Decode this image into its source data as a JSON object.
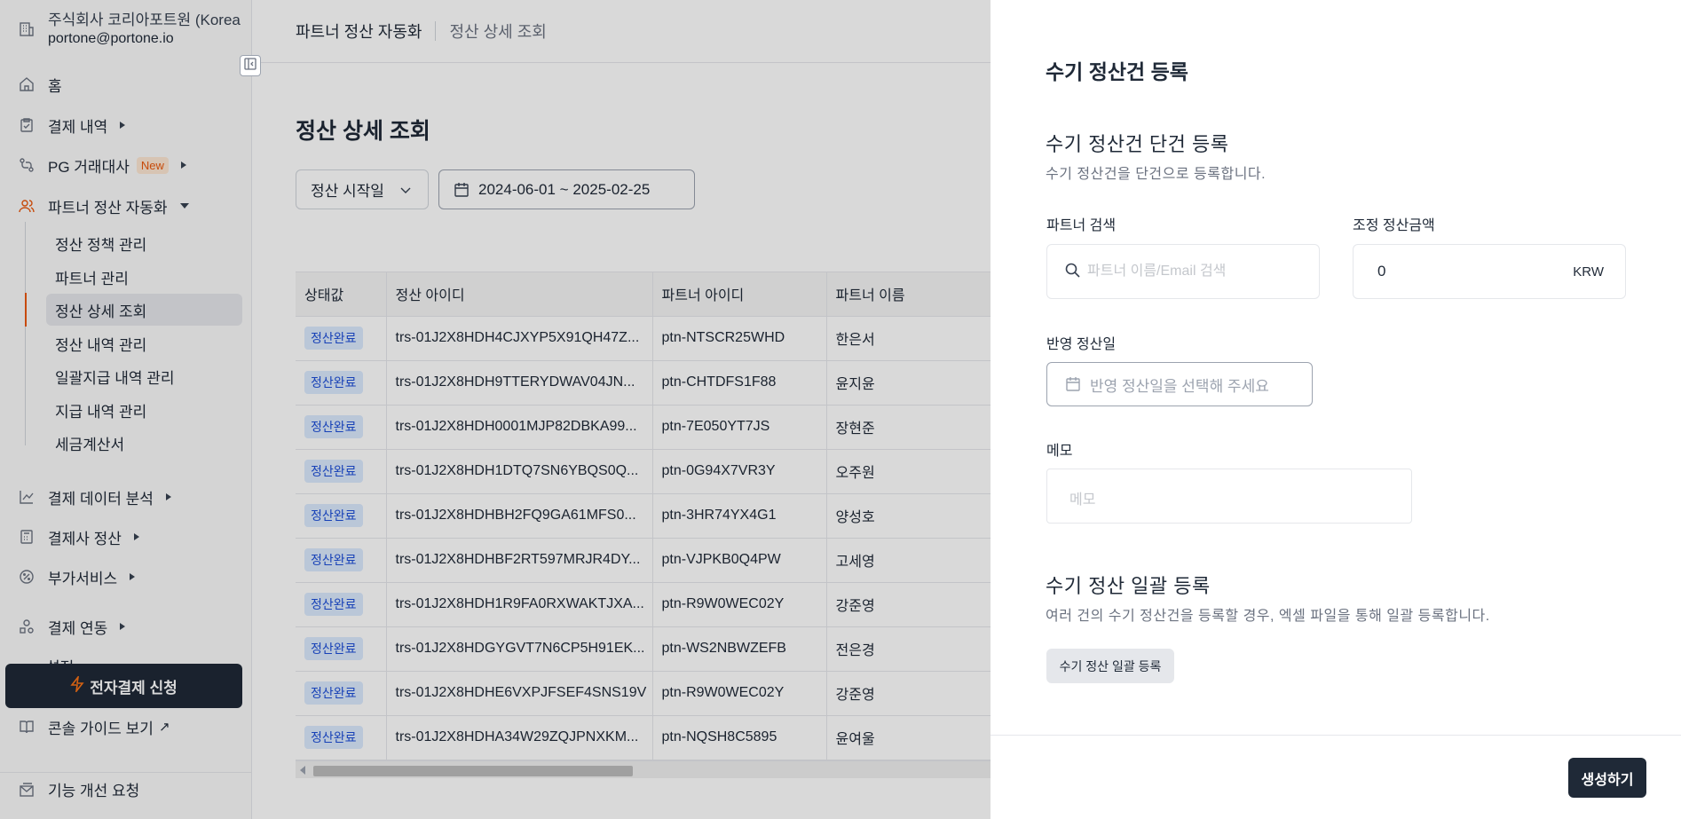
{
  "org": {
    "name": "주식회사 코리아포트원 (Korea",
    "email": "portone@portone.io"
  },
  "nav": {
    "home": "홈",
    "payments": "결제 내역",
    "pg": "PG 거래대사",
    "pg_badge": "New",
    "partner": "파트너 정산 자동화",
    "sub": [
      "정산 정책 관리",
      "파트너 관리",
      "정산 상세 조회",
      "정산 내역 관리",
      "일괄지급 내역 관리",
      "지급 내역 관리",
      "세금계산서"
    ],
    "analytics": "결제 데이터 분석",
    "settlement": "결제사 정산",
    "addon": "부가서비스",
    "integration": "결제 연동",
    "partial": "설정"
  },
  "apply_button": "전자결제 신청",
  "guide": "콘솔 가이드 보기",
  "feedback": "기능 개선 요청",
  "breadcrumb": {
    "first": "파트너 정산 자동화",
    "second": "정산 상세 조회"
  },
  "page_title": "정산 상세 조회",
  "filters": {
    "date_type": "정산 시작일",
    "date_range": "2024-06-01 ~ 2025-02-25"
  },
  "table": {
    "headers": [
      "상태값",
      "정산 아이디",
      "파트너 아이디",
      "파트너 이름"
    ],
    "rows": [
      [
        "정산완료",
        "trs-01J2X8HDH4CJXYP5X91QH47Z...",
        "ptn-NTSCR25WHD",
        "한은서"
      ],
      [
        "정산완료",
        "trs-01J2X8HDH9TTERYDWAV04JN...",
        "ptn-CHTDFS1F88",
        "윤지윤"
      ],
      [
        "정산완료",
        "trs-01J2X8HDH0001MJP82DBKA99...",
        "ptn-7E050YT7JS",
        "장현준"
      ],
      [
        "정산완료",
        "trs-01J2X8HDH1DTQ7SN6YBQS0Q...",
        "ptn-0G94X7VR3Y",
        "오주원"
      ],
      [
        "정산완료",
        "trs-01J2X8HDHBH2FQ9GA61MFS0...",
        "ptn-3HR74YX4G1",
        "양성호"
      ],
      [
        "정산완료",
        "trs-01J2X8HDHBF2RT597MRJR4DY...",
        "ptn-VJPKB0Q4PW",
        "고세영"
      ],
      [
        "정산완료",
        "trs-01J2X8HDH1R9FA0RXWAKTJXA...",
        "ptn-R9W0WEC02Y",
        "강준영"
      ],
      [
        "정산완료",
        "trs-01J2X8HDGYGVT7N6CP5H91EK...",
        "ptn-WS2NBWZEFB",
        "전은경"
      ],
      [
        "정산완료",
        "trs-01J2X8HDHE6VXPJFSEF4SNS19V",
        "ptn-R9W0WEC02Y",
        "강준영"
      ],
      [
        "정산완료",
        "trs-01J2X8HDHA34W29ZQJPNXKM...",
        "ptn-NQSH8C5895",
        "윤여울"
      ]
    ]
  },
  "drawer": {
    "title": "수기 정산건 등록",
    "single_title": "수기 정산건 단건 등록",
    "single_desc": "수기 정산건을 단건으로 등록합니다.",
    "partner_label": "파트너 검색",
    "partner_placeholder": "파트너 이름/Email 검색",
    "amount_label": "조정 정산금액",
    "amount_value": "0",
    "amount_currency": "KRW",
    "date_label": "반영 정산일",
    "date_placeholder": "반영 정산일을 선택해 주세요",
    "memo_label": "메모",
    "memo_placeholder": "메모",
    "bulk_title": "수기 정산 일괄 등록",
    "bulk_desc": "여러 건의 수기 정산건을 등록할 경우, 엑셀 파일을 통해 일괄 등록합니다.",
    "bulk_button": "수기 정산 일괄 등록",
    "create_button": "생성하기"
  },
  "colors": {
    "accent": "#ea580c",
    "primary_button": "#1f2937",
    "status_bg": "#dbeafe",
    "status_text": "#1d4ed8"
  }
}
